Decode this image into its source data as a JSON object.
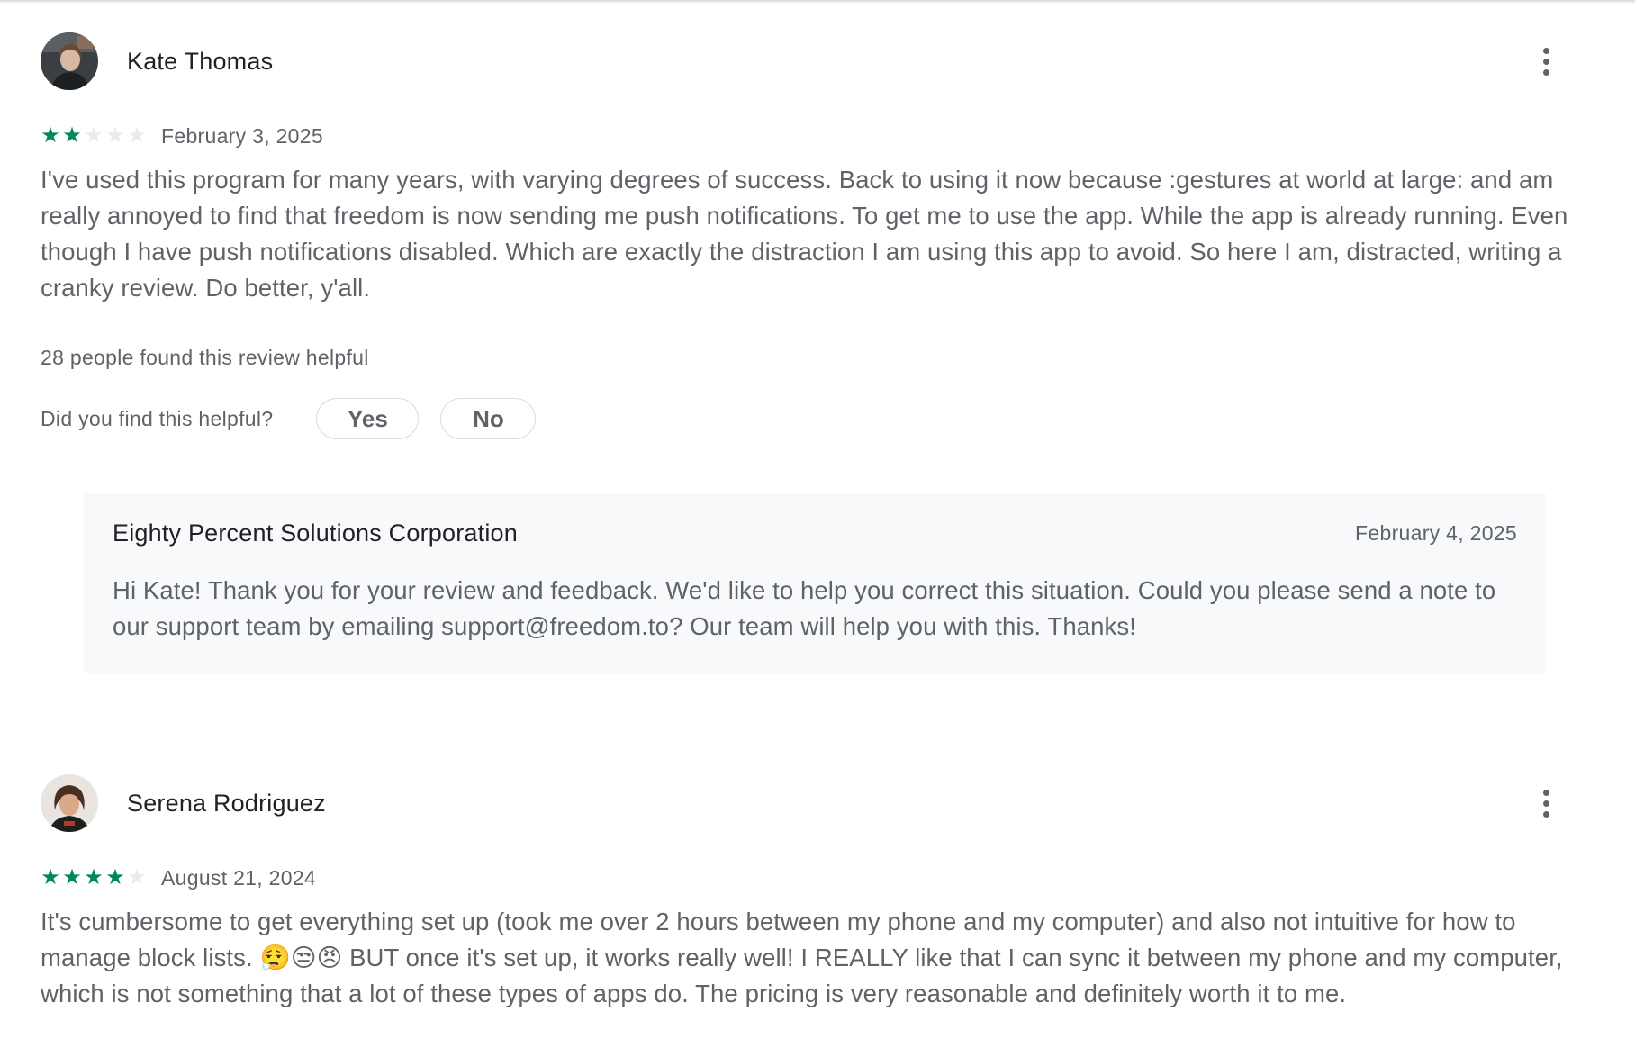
{
  "reviews": [
    {
      "author": "Kate Thomas",
      "rating": 2,
      "max_rating": 5,
      "date": "February 3, 2025",
      "text": "I've used this program for many years, with varying degrees of success. Back to using it now because :gestures at world at large: and am really annoyed to find that freedom is now sending me push notifications. To get me to use the app. While the app is already running. Even though I have push notifications disabled. Which are exactly the distraction I am using this app to avoid. So here I am, distracted, writing a cranky review. Do better, y'all.",
      "helpful_count": "28 people found this review helpful",
      "helpful_question": "Did you find this helpful?",
      "yes_label": "Yes",
      "no_label": "No",
      "developer_reply": {
        "name": "Eighty Percent Solutions Corporation",
        "date": "February 4, 2025",
        "text": "Hi Kate! Thank you for your review and feedback. We'd like to help you correct this situation. Could you please send a note to our support team by emailing support@freedom.to? Our team will help you with this. Thanks!"
      }
    },
    {
      "author": "Serena Rodriguez",
      "rating": 4,
      "max_rating": 5,
      "date": "August 21, 2024",
      "text": "It's cumbersome to get everything set up (took me over 2 hours between my phone and my computer) and also not intuitive for how to manage block lists. 😮‍💨😒😠 BUT once it's set up, it works really well! I REALLY like that I can sync it between my phone and my computer, which is not something that a lot of these types of apps do. The pricing is very reasonable and definitely worth it to me."
    }
  ],
  "icons": {
    "more": "more-vert-icon",
    "star": "star-icon"
  },
  "colors": {
    "star_filled": "#01875f",
    "star_empty": "#e8eaed",
    "reply_background": "#f8f9fa",
    "secondary_text": "#5f6368",
    "primary_text": "#202124"
  }
}
